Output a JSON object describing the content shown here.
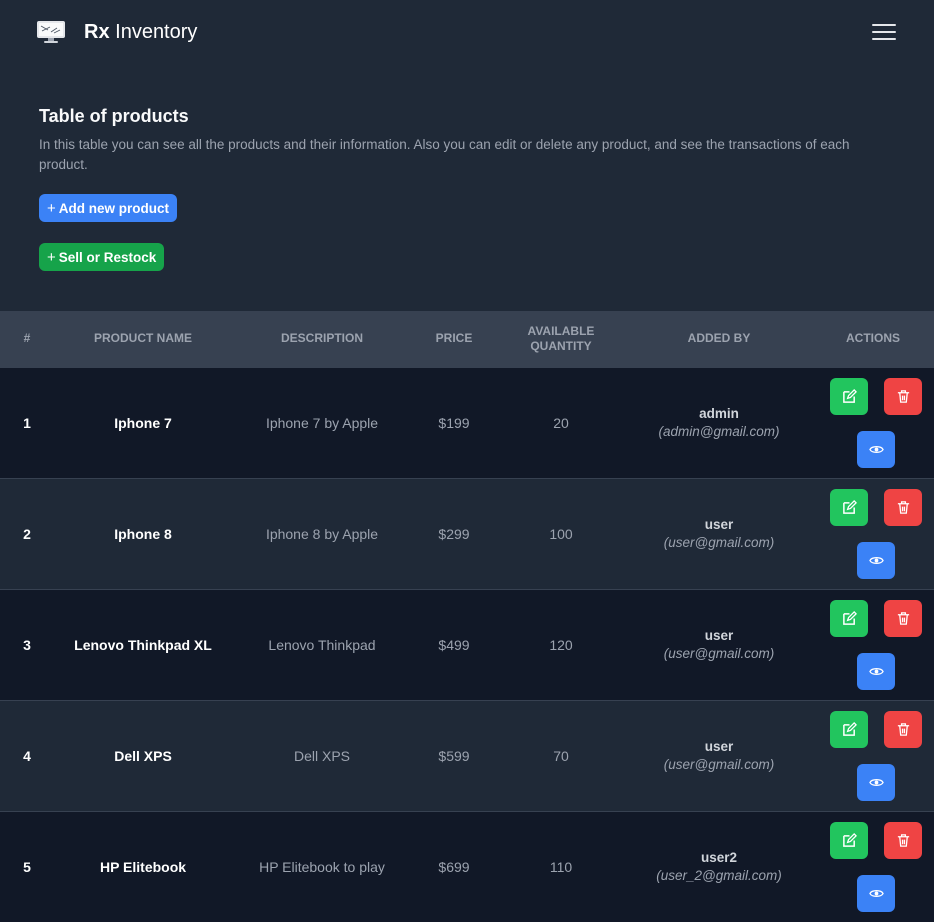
{
  "navbar": {
    "brand_bold": "Rx",
    "brand_rest": " Inventory"
  },
  "intro": {
    "title": "Table of products",
    "description": "In this table you can see all the products and their information. Also you can edit or delete any product, and see the transactions of each product.",
    "add_label": "Add new product",
    "sell_label": "Sell or Restock",
    "plus": "+"
  },
  "table": {
    "headers": {
      "num": "#",
      "name": "Product Name",
      "description": "Description",
      "price": "Price",
      "quantity": "Available Quantity",
      "added_by": "Added By",
      "actions": "Actions"
    },
    "rows": [
      {
        "num": "1",
        "name": "Iphone 7",
        "description": "Iphone 7 by Apple",
        "price": "$199",
        "quantity": "20",
        "user": "admin",
        "email": "(admin@gmail.com)"
      },
      {
        "num": "2",
        "name": "Iphone 8",
        "description": "Iphone 8 by Apple",
        "price": "$299",
        "quantity": "100",
        "user": "user",
        "email": "(user@gmail.com)"
      },
      {
        "num": "3",
        "name": "Lenovo Thinkpad XL",
        "description": "Lenovo Thinkpad",
        "price": "$499",
        "quantity": "120",
        "user": "user",
        "email": "(user@gmail.com)"
      },
      {
        "num": "4",
        "name": "Dell XPS",
        "description": "Dell XPS",
        "price": "$599",
        "quantity": "70",
        "user": "user",
        "email": "(user@gmail.com)"
      },
      {
        "num": "5",
        "name": "HP Elitebook",
        "description": "HP Elitebook to play",
        "price": "$699",
        "quantity": "110",
        "user": "user2",
        "email": "(user_2@gmail.com)"
      }
    ]
  },
  "icons": {
    "logo": "monitor-logo-icon",
    "menu": "hamburger-menu-icon",
    "edit": "edit-icon",
    "delete": "trash-icon",
    "view": "eye-icon"
  },
  "colors": {
    "add_button": "#3b82f6",
    "sell_button": "#16a34a",
    "edit_button": "#22c55e",
    "delete_button": "#ef4444",
    "view_button": "#3b82f6"
  }
}
